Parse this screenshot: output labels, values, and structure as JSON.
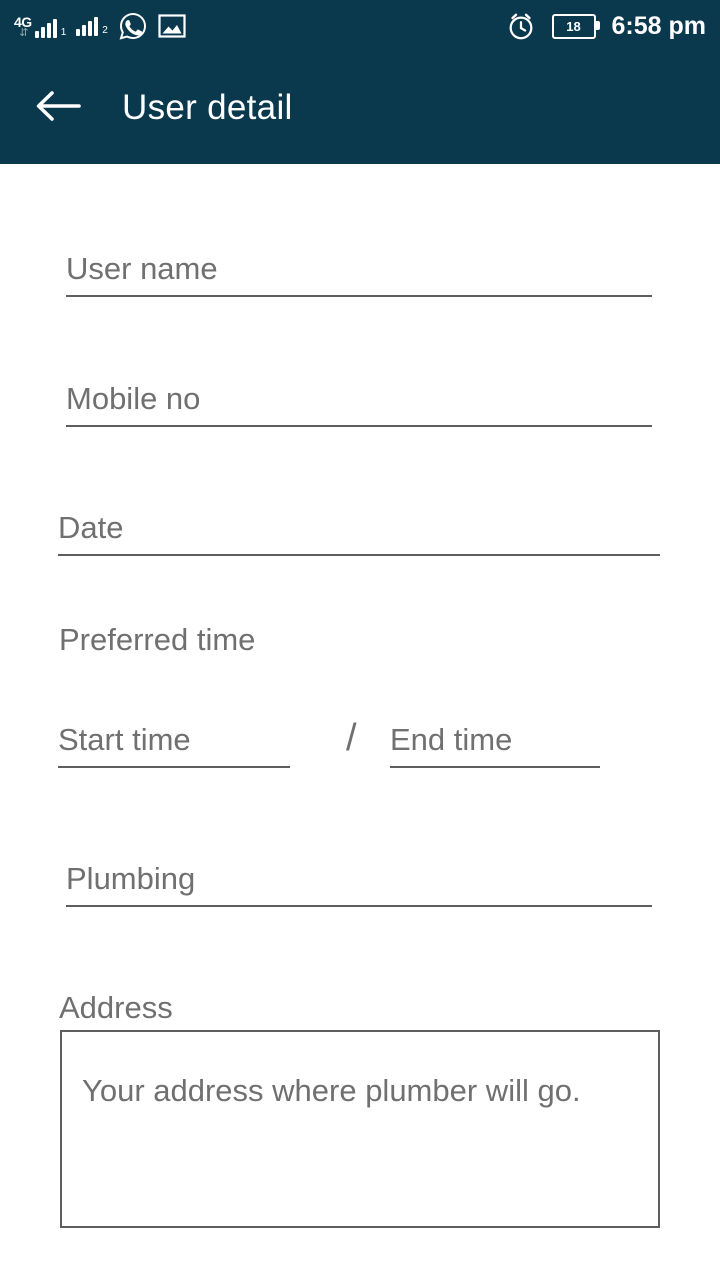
{
  "status_bar": {
    "network_label": "4G",
    "sim1_label": "1",
    "sim2_label": "2",
    "whatsapp_icon": "whatsapp-icon",
    "gallery_icon": "image-icon",
    "alarm_icon": "alarm-clock-icon",
    "battery_level": "18",
    "time": "6:58 pm",
    "background_color": "#0a384d"
  },
  "app_bar": {
    "back_icon": "back-arrow-icon",
    "title": "User detail",
    "background_color": "#0a384d",
    "text_color": "#ffffff"
  },
  "form": {
    "user_name": {
      "placeholder": "User name",
      "value": ""
    },
    "mobile_no": {
      "placeholder": "Mobile no",
      "value": ""
    },
    "date": {
      "placeholder": "Date",
      "value": ""
    },
    "preferred_time_label": "Preferred time",
    "start_time": {
      "placeholder": "Start time",
      "value": ""
    },
    "time_separator": "/",
    "end_time": {
      "placeholder": "End time",
      "value": ""
    },
    "service_type": {
      "value": "Plumbing"
    },
    "address_label": "Address",
    "address": {
      "placeholder": "Your address where plumber will go.",
      "value": ""
    }
  },
  "colors": {
    "primary": "#0a384d",
    "hint_text": "#707070",
    "underline": "#5e5e5e",
    "page_background": "#ffffff"
  }
}
